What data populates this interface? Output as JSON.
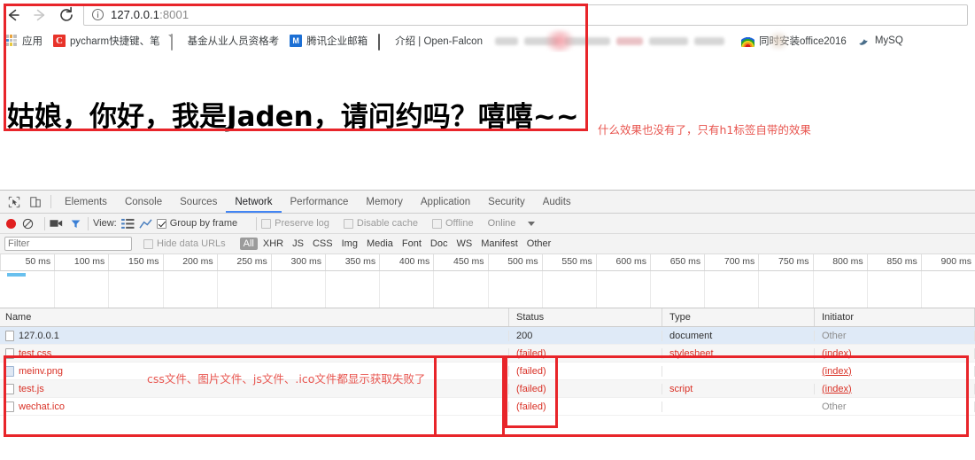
{
  "browser": {
    "nav": {
      "back_label": "Back",
      "forward_label": "Forward",
      "reload_label": "Reload"
    },
    "address": {
      "host": "127.0.0.1",
      "port": ":8001",
      "info_icon": "info-circle-icon"
    },
    "bookmarks": [
      {
        "label": "应用",
        "icon": "apps-grid-icon"
      },
      {
        "label": "pycharm快捷键、笔",
        "icon": "c-red-icon"
      },
      {
        "label": "基金从业人员资格考",
        "icon": "document-icon"
      },
      {
        "label": "腾讯企业邮箱",
        "icon": "tencent-mail-icon"
      },
      {
        "label": "介绍 | Open-Falcon",
        "icon": "book-icon"
      },
      {
        "label": "",
        "icon": "redacted-blur"
      },
      {
        "label": "同时安装office2016",
        "icon": "rainbow-icon"
      },
      {
        "label": "MySQ",
        "icon": "mysql-dolphin-icon"
      }
    ]
  },
  "page": {
    "heading": "姑娘，你好，我是Jaden，请问约吗？嘻嘻~~"
  },
  "annotations": {
    "page_note": "什么效果也没有了，只有h1标签自带的效果",
    "network_note": "css文件、图片文件、js文件、.ico文件都显示获取失败了",
    "box_color": "#e8252a",
    "note_color": "#e8554f"
  },
  "devtools": {
    "tabs": [
      {
        "label": "Elements",
        "active": false
      },
      {
        "label": "Console",
        "active": false
      },
      {
        "label": "Sources",
        "active": false
      },
      {
        "label": "Network",
        "active": true
      },
      {
        "label": "Performance",
        "active": false
      },
      {
        "label": "Memory",
        "active": false
      },
      {
        "label": "Application",
        "active": false
      },
      {
        "label": "Security",
        "active": false
      },
      {
        "label": "Audits",
        "active": false
      }
    ],
    "inspect_icon": "inspect-cursor-icon",
    "device_icon": "device-toolbar-icon",
    "toolbar": {
      "record_icon": "record-dot-icon",
      "clear_icon": "clear-circle-slash-icon",
      "capture_screenshots_icon": "camera-icon",
      "filter_icon": "funnel-icon",
      "view_label": "View:",
      "view_list_icon": "list-view-icon",
      "view_timeline_icon": "timeline-view-icon",
      "group_by_frame": {
        "label": "Group by frame",
        "checked": true
      },
      "preserve_log": {
        "label": "Preserve log",
        "checked": false
      },
      "disable_cache": {
        "label": "Disable cache",
        "checked": false
      },
      "offline": {
        "label": "Offline",
        "checked": false
      },
      "online_label": "Online",
      "more_icon": "chevron-down-icon"
    },
    "filterbar": {
      "filter_placeholder": "Filter",
      "filter_value": "",
      "hide_data_urls": {
        "label": "Hide data URLs",
        "checked": false
      },
      "types": [
        "All",
        "XHR",
        "JS",
        "CSS",
        "Img",
        "Media",
        "Font",
        "Doc",
        "WS",
        "Manifest",
        "Other"
      ],
      "selected_type": "All"
    },
    "timeline_ticks": [
      "50 ms",
      "100 ms",
      "150 ms",
      "200 ms",
      "250 ms",
      "300 ms",
      "350 ms",
      "400 ms",
      "450 ms",
      "500 ms",
      "550 ms",
      "600 ms",
      "650 ms",
      "700 ms",
      "750 ms",
      "800 ms",
      "850 ms",
      "900 ms"
    ],
    "table": {
      "columns": [
        "Name",
        "Status",
        "Type",
        "Initiator"
      ],
      "rows": [
        {
          "name": "127.0.0.1",
          "status": "200",
          "type": "document",
          "initiator": "Other",
          "failed": false,
          "selected": true,
          "icon": "document-icon",
          "initiator_link": false
        },
        {
          "name": "test.css",
          "status": "(failed)",
          "type": "stylesheet",
          "initiator": "(index)",
          "failed": true,
          "selected": false,
          "icon": "stylesheet-icon",
          "initiator_link": true
        },
        {
          "name": "meinv.png",
          "status": "(failed)",
          "type": "",
          "initiator": "(index)",
          "failed": true,
          "selected": false,
          "icon": "image-icon",
          "initiator_link": true
        },
        {
          "name": "test.js",
          "status": "(failed)",
          "type": "script",
          "initiator": "(index)",
          "failed": true,
          "selected": false,
          "icon": "script-icon",
          "initiator_link": true
        },
        {
          "name": "wechat.ico",
          "status": "(failed)",
          "type": "",
          "initiator": "Other",
          "failed": true,
          "selected": false,
          "icon": "icon-file-icon",
          "initiator_link": false
        }
      ]
    }
  }
}
